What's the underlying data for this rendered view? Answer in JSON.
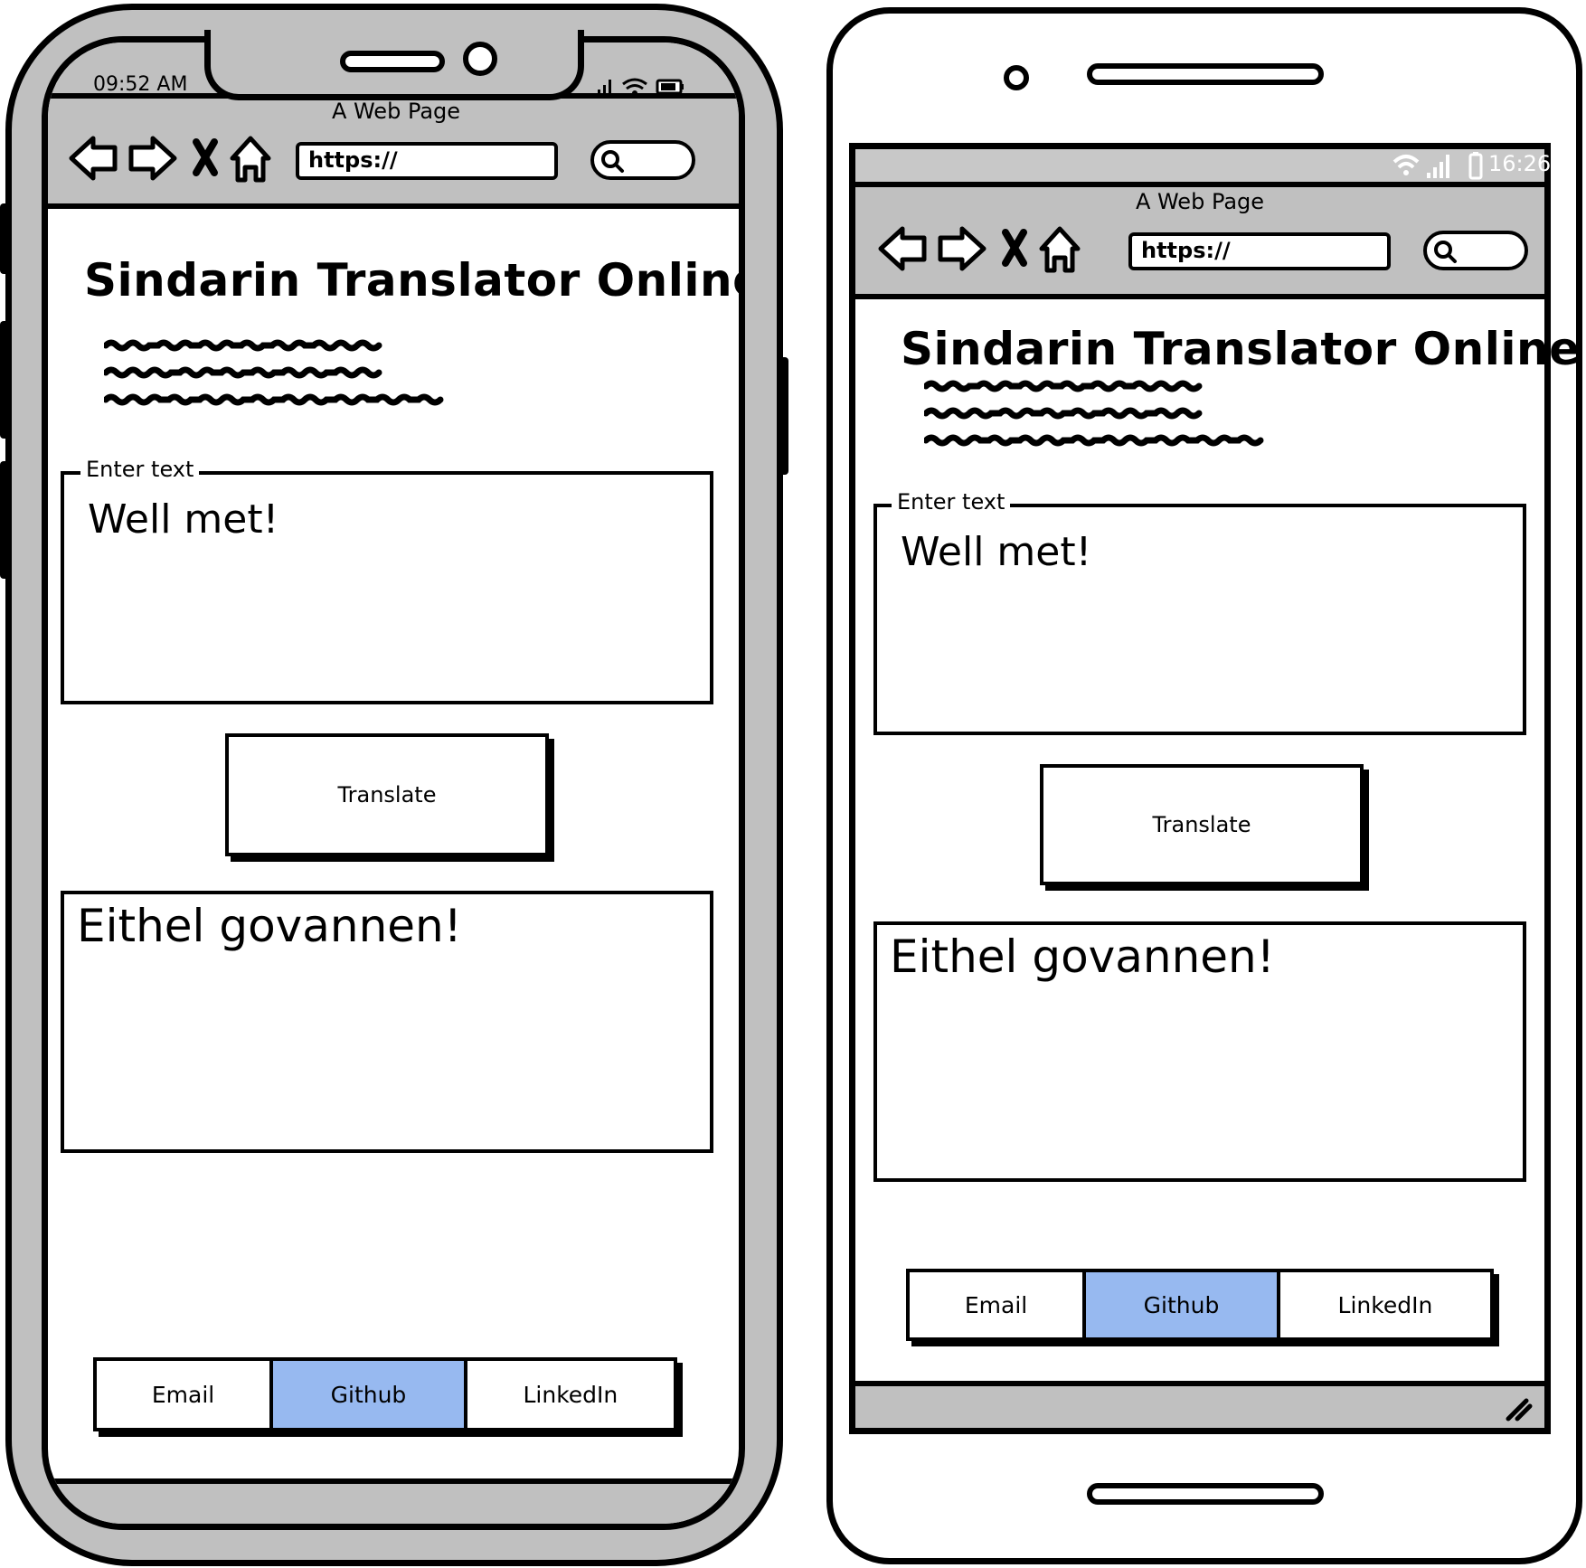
{
  "iphone": {
    "status": {
      "time": "09:52 AM"
    },
    "browser": {
      "title": "A Web Page",
      "url": "https://"
    },
    "page": {
      "heading": "Sindarin Translator Online",
      "input_label": "Enter text",
      "input_value": "Well met!",
      "translate_label": "Translate",
      "output_value": "Eithel govannen!",
      "links": [
        {
          "label": "Email",
          "active": false
        },
        {
          "label": "Github",
          "active": true
        },
        {
          "label": "LinkedIn",
          "active": false
        }
      ]
    }
  },
  "android": {
    "status": {
      "time": "16:26"
    },
    "browser": {
      "title": "A Web Page",
      "url": "https://"
    },
    "page": {
      "heading": "Sindarin Translator Online",
      "input_label": "Enter text",
      "input_value": "Well met!",
      "translate_label": "Translate",
      "output_value": "Eithel govannen!",
      "links": [
        {
          "label": "Email",
          "active": false
        },
        {
          "label": "Github",
          "active": true
        },
        {
          "label": "LinkedIn",
          "active": false
        }
      ]
    }
  },
  "colors": {
    "device_gray": "#c0c0c0",
    "active_link": "#97b9f0",
    "outline": "#000000"
  },
  "icons": [
    "back-arrow-icon",
    "forward-arrow-icon",
    "close-icon",
    "home-icon",
    "search-icon",
    "signal-icon",
    "wifi-icon",
    "battery-icon",
    "resize-grip-icon"
  ]
}
